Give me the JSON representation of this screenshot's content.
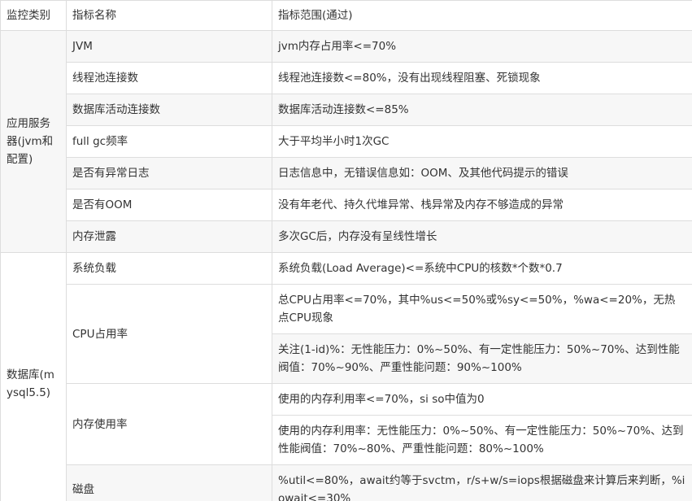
{
  "header": {
    "category": "监控类别",
    "name": "指标名称",
    "range": "指标范围(通过)"
  },
  "groups": [
    {
      "category": "应用服务器(jvm和配置)",
      "rows": [
        {
          "name": "JVM",
          "range": "jvm内存占用率<=70%"
        },
        {
          "name": "线程池连接数",
          "range": "线程池连接数<=80%，没有出现线程阻塞、死锁现象"
        },
        {
          "name": "数据库活动连接数",
          "range": "数据库活动连接数<=85%"
        },
        {
          "name": "full gc频率",
          "range": "大于平均半小时1次GC"
        },
        {
          "name": "是否有异常日志",
          "range": "日志信息中，无错误信息如：OOM、及其他代码提示的错误"
        },
        {
          "name": "是否有OOM",
          "range": "没有年老代、持久代堆异常、栈异常及内存不够造成的异常"
        },
        {
          "name": "内存泄露",
          "range": "多次GC后，内存没有呈线性增长"
        }
      ]
    },
    {
      "category": "数据库(mysql5.5)",
      "rows": [
        {
          "name": "系统负载",
          "ranges": [
            "系统负载(Load Average)<=系统中CPU的核数*个数*0.7"
          ]
        },
        {
          "name": "CPU占用率",
          "ranges": [
            "总CPU占用率<=70%，其中%us<=50%或%sy<=50%，%wa<=20%，无热点CPU现象",
            "关注(1-id)%：无性能压力：0%~50%、有一定性能压力：50%~70%、达到性能阀值：70%~90%、严重性能问题：90%~100%"
          ]
        },
        {
          "name": "内存使用率",
          "ranges": [
            "使用的内存利用率<=70%，si so中值为0",
            "使用的内存利用率：无性能压力：0%~50%、有一定性能压力：50%~70%、达到性能阀值：70%~80%、严重性能问题：80%~100%"
          ]
        },
        {
          "name": "磁盘",
          "ranges": [
            "%util<=80%，await约等于svctm，r/s+w/s=iops根据磁盘来计算后来判断，%iowait<=30%"
          ]
        }
      ]
    }
  ]
}
